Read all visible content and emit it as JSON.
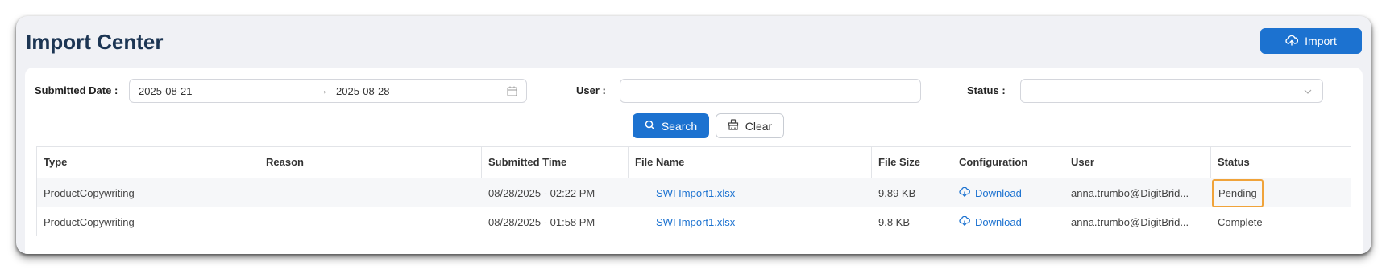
{
  "page": {
    "title": "Import Center"
  },
  "header": {
    "import_label": "Import"
  },
  "filters": {
    "submitted_date_label": "Submitted Date :",
    "start_date": "2025-08-21",
    "arrow": "→",
    "end_date": "2025-08-28",
    "user_label": "User :",
    "user_value": "",
    "status_label": "Status :",
    "status_value": "",
    "search_label": "Search",
    "clear_label": "Clear"
  },
  "table": {
    "columns": [
      "Type",
      "Reason",
      "Submitted Time",
      "File Name",
      "File Size",
      "Configuration",
      "User",
      "Status"
    ],
    "rows": [
      {
        "type": "ProductCopywriting",
        "reason": "",
        "submitted_time": "08/28/2025 - 02:22 PM",
        "file_name": "SWI Import1.xlsx",
        "file_size": "9.89 KB",
        "configuration": "Download",
        "user": "anna.trumbo@DigitBrid...",
        "status": "Pending"
      },
      {
        "type": "ProductCopywriting",
        "reason": "",
        "submitted_time": "08/28/2025 - 01:58 PM",
        "file_name": "SWI Import1.xlsx",
        "file_size": "9.8 KB",
        "configuration": "Download",
        "user": "anna.trumbo@DigitBrid...",
        "status": "Complete"
      }
    ]
  },
  "colors": {
    "primary": "#1c72d0",
    "title": "#1c3553",
    "highlight": "#f0a33a"
  },
  "icons": {
    "import": "cloud-upload-icon",
    "search": "search-icon",
    "clear": "clear-broom-icon",
    "calendar": "calendar-icon",
    "dropdown": "chevron-down-icon",
    "download": "cloud-download-icon"
  }
}
